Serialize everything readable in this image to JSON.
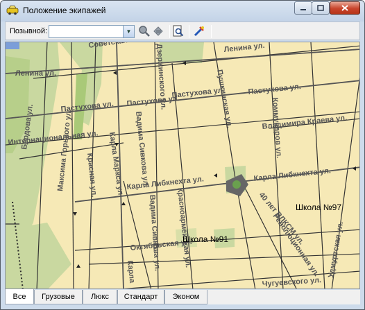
{
  "window": {
    "title": "Положение экипажей",
    "minimize_icon": "minimize-icon",
    "maximize_icon": "maximize-icon",
    "close_icon": "close-icon"
  },
  "toolbar": {
    "callsign_label": "Позывной:",
    "callsign_value": "",
    "buttons": [
      {
        "name": "zoom-icon"
      },
      {
        "name": "locate-icon"
      },
      {
        "name": "preview-icon"
      },
      {
        "name": "settings-icon"
      }
    ]
  },
  "map": {
    "street_labels": [
      "Советская",
      "Ленина ул.",
      "Ленина ул.",
      "Бердова ул.",
      "Максима Горького ул.",
      "Пастухова ул.",
      "Пастухова ул.",
      "Пастухова ул.",
      "Пастухова ул.",
      "Карла Маркса ул.",
      "Вадима Сивкова ул.",
      "Дзержинского ул.",
      "Пушкинская ул.",
      "Коммунаров ул.",
      "Владимира Краева ул.",
      "Интернациональная ул.",
      "Красная ул.",
      "Карла Либкнехта ул.",
      "Карла Либкнехта ул.",
      "Красноармейская ул.",
      "Вадима Сивкова ул.",
      "40 лет ВЛКСМ ул.",
      "Революционная ул.",
      "Удмуртская ул.",
      "Октябрьская ул.",
      "Чугуевского ул.",
      "Карла"
    ],
    "poi_labels": [
      "Школа №97",
      "Школа №91"
    ]
  },
  "tabs": [
    "Все",
    "Грузовые",
    "Люкс",
    "Стандарт",
    "Эконом"
  ],
  "active_tab": "Все"
}
